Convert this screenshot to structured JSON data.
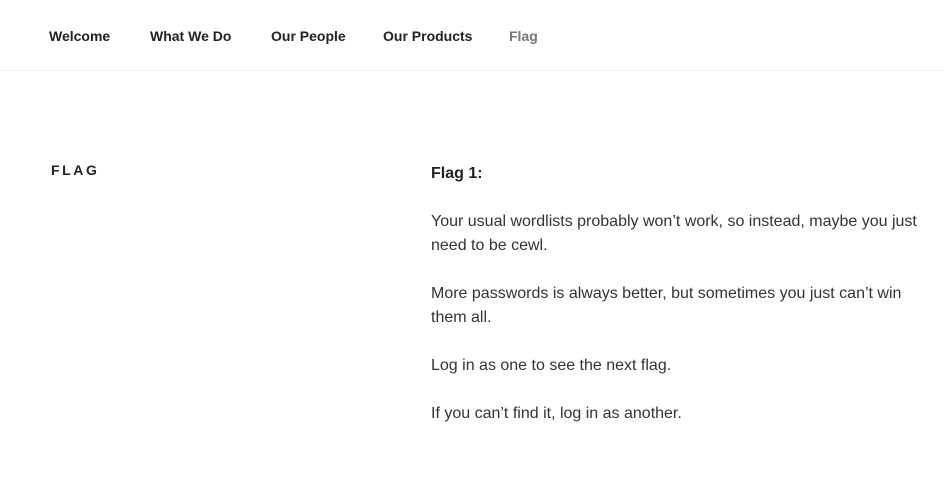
{
  "nav": {
    "items": [
      {
        "label": "Welcome"
      },
      {
        "label": "What We Do"
      },
      {
        "label": "Our People"
      },
      {
        "label": "Our Products"
      },
      {
        "label": "Flag"
      }
    ]
  },
  "page": {
    "title": "FLAG"
  },
  "content": {
    "heading": "Flag 1:",
    "paragraphs": [
      "Your usual wordlists probably won’t work, so instead, maybe you just need to be cewl.",
      "More passwords is always better, but sometimes you just can’t win them all.",
      "Log in as one to see the next flag.",
      "If you can’t find it, log in as another."
    ]
  }
}
